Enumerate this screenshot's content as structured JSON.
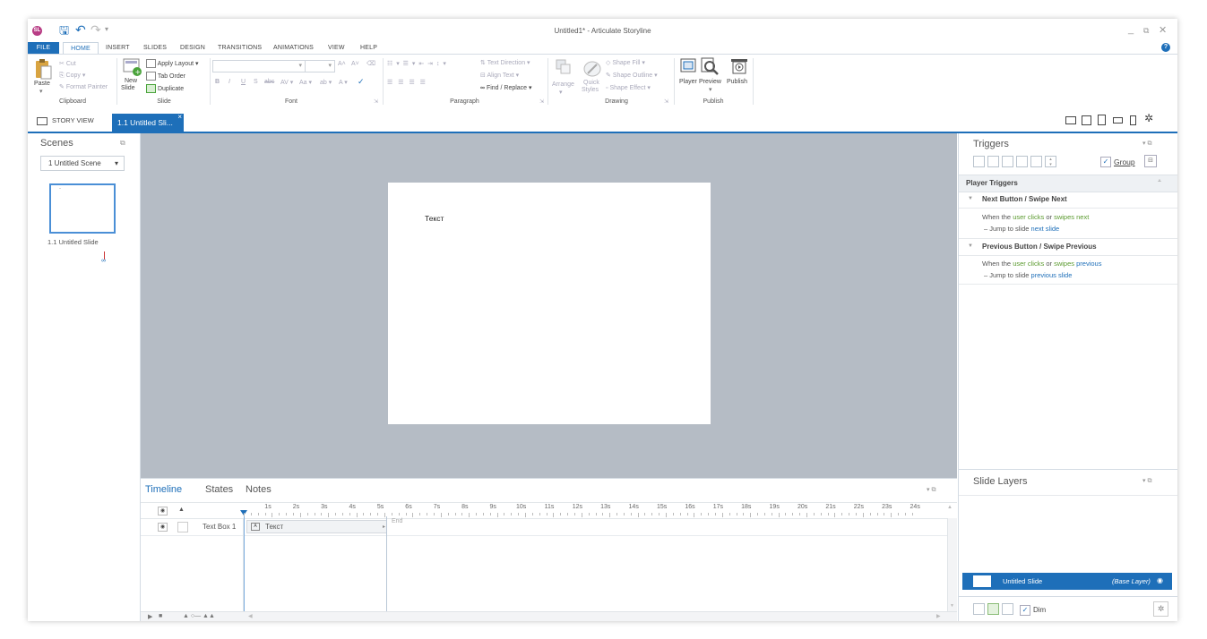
{
  "window": {
    "title": "Untitled1* - Articulate Storyline",
    "logo_text": "SL"
  },
  "quick_access": {
    "save": "🖫",
    "undo": "↶",
    "redo": "↷",
    "customize": "▾"
  },
  "ribbon_tabs": [
    "FILE",
    "HOME",
    "INSERT",
    "SLIDES",
    "DESIGN",
    "TRANSITIONS",
    "ANIMATIONS",
    "VIEW",
    "HELP"
  ],
  "ribbon": {
    "clipboard": {
      "paste": "Paste",
      "cut": "Cut",
      "copy": "Copy",
      "format_painter": "Format Painter",
      "label": "Clipboard"
    },
    "slide": {
      "new_slide": "New",
      "new_slide2": "Slide",
      "apply_layout": "Apply Layout",
      "tab_order": "Tab Order",
      "duplicate": "Duplicate",
      "label": "Slide"
    },
    "font": {
      "label": "Font",
      "bold": "B",
      "italic": "I",
      "underline": "U",
      "shadow": "S",
      "strike": "abc",
      "spacing": "AV",
      "case": "Aa",
      "highlight": "ab",
      "color": "A",
      "grow": "A˄",
      "shrink": "A˅"
    },
    "paragraph": {
      "text_direction": "Text Direction",
      "align_text": "Align Text",
      "find_replace": "Find / Replace",
      "label": "Paragraph"
    },
    "drawing": {
      "arrange": "Arrange",
      "quick_styles": "Quick",
      "quick_styles2": "Styles",
      "shape_fill": "Shape Fill",
      "shape_outline": "Shape Outline",
      "shape_effect": "Shape Effect",
      "label": "Drawing"
    },
    "publish": {
      "player": "Player",
      "preview": "Preview",
      "publish": "Publish",
      "label": "Publish"
    }
  },
  "doc_tabs": {
    "story_view": "STORY VIEW",
    "slide_tab": "1.1 Untitled Sli...",
    "close": "×"
  },
  "scenes": {
    "title": "Scenes",
    "dropdown": "1 Untitled Scene",
    "thumb_label": "1.1 Untitled Slide",
    "thumb_mark": "-"
  },
  "slide": {
    "text": "Текст"
  },
  "timeline": {
    "tabs": [
      "Timeline",
      "States",
      "Notes"
    ],
    "ticks": [
      "1s",
      "2s",
      "3s",
      "4s",
      "5s",
      "6s",
      "7s",
      "8s",
      "9s",
      "10s",
      "11s",
      "12s",
      "13s",
      "14s",
      "15s",
      "16s",
      "17s",
      "18s",
      "19s",
      "20s",
      "21s",
      "22s",
      "23s",
      "24s"
    ],
    "row_label": "Text Box 1",
    "bar_label": "Текст",
    "end_label": "End"
  },
  "triggers": {
    "title": "Triggers",
    "group_label": "Group",
    "section": "Player Triggers",
    "items": [
      {
        "title": "Next Button / Swipe Next",
        "pre": "When the",
        "user": "user",
        "verb": "clicks",
        "or": "or",
        "verb2": "swipes",
        "target": "next",
        "action_pre": "– Jump to slide",
        "action_target": "next slide"
      },
      {
        "title": "Previous Button / Swipe Previous",
        "pre": "When the",
        "user": "user",
        "verb": "clicks",
        "or": "or",
        "verb2": "swipes",
        "target": "previous",
        "action_pre": "– Jump to slide",
        "action_target": "previous slide"
      }
    ]
  },
  "layers": {
    "title": "Slide Layers",
    "base_name": "Untitled Slide",
    "base_tag": "(Base Layer)",
    "dim_label": "Dim"
  },
  "colors": {
    "accent": "#1e6fb9",
    "stage": "#b5bcc5",
    "link_green": "#5a9a2e",
    "link_blue": "#1e6fb9"
  }
}
